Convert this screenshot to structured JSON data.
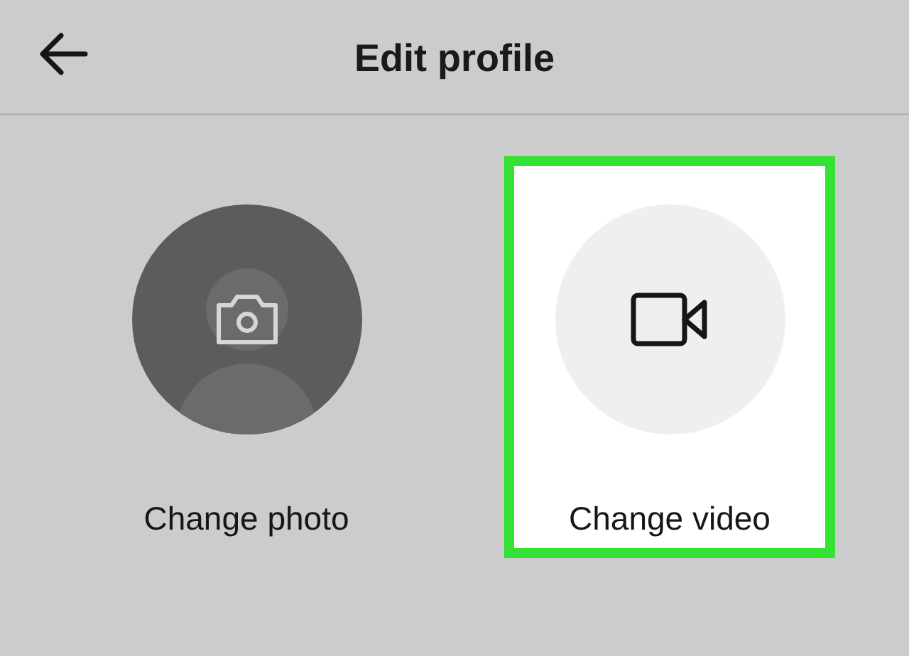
{
  "header": {
    "title": "Edit profile"
  },
  "options": [
    {
      "kind": "photo",
      "label": "Change photo",
      "selected": false
    },
    {
      "kind": "video",
      "label": "Change video",
      "selected": true
    }
  ]
}
